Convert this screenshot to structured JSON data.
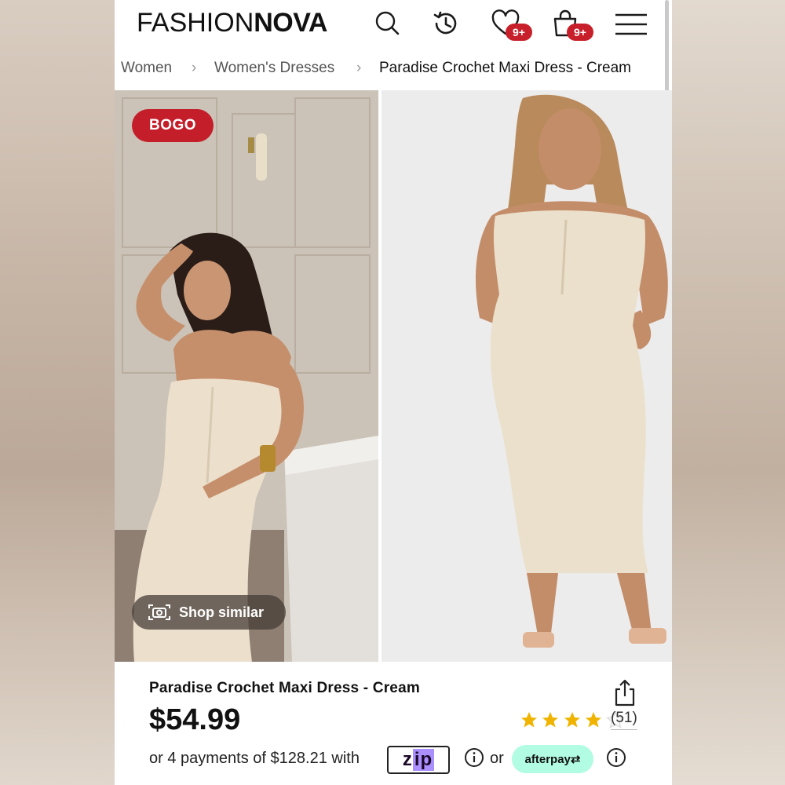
{
  "header": {
    "logo_part1": "FASHION",
    "logo_part2": "NOVA",
    "wishlist_badge": "9+",
    "cart_badge": "9+"
  },
  "breadcrumb": {
    "items": [
      "Women",
      "Women's Dresses",
      "Paradise Crochet Maxi Dress - Cream"
    ]
  },
  "gallery": {
    "badge": "BOGO",
    "shop_similar_label": "Shop similar"
  },
  "product": {
    "title": "Paradise Crochet Maxi Dress - Cream",
    "price": "$54.99",
    "rating": 4,
    "rating_max": 5,
    "review_count": "(51)",
    "payments_text": "or 4 payments of $128.21 with",
    "zip_label_a": "z",
    "zip_label_b": "ip",
    "or_text": "or",
    "afterpay_label": "afterpay⇄"
  },
  "colors": {
    "badge_red": "#c8202a",
    "star_gold": "#f0b400",
    "afterpay_mint": "#b2fce4",
    "zip_purple": "#aa8fff"
  }
}
